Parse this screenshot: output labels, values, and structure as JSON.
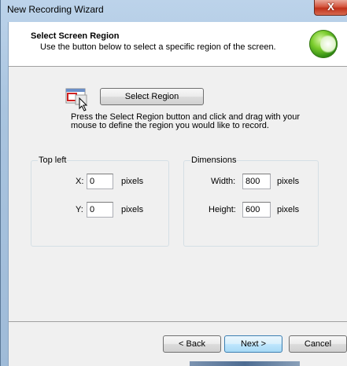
{
  "window": {
    "title": "New Recording Wizard",
    "close_glyph": "X"
  },
  "header": {
    "title": "Select Screen Region",
    "subtitle": "Use the button below to select a specific region of the screen.",
    "logo_icon": "camtasia-logo-icon"
  },
  "region": {
    "icon": "region-select-icon",
    "button_label": "Select Region",
    "instructions_line1": "Press the Select Region button and click and drag with your",
    "instructions_line2": "mouse to define the region you would like to record."
  },
  "top_left": {
    "group_label": "Top left",
    "x_label": "X:",
    "x_value": "0",
    "x_unit": "pixels",
    "y_label": "Y:",
    "y_value": "0",
    "y_unit": "pixels"
  },
  "dimensions": {
    "group_label": "Dimensions",
    "width_label": "Width:",
    "width_value": "800",
    "width_unit": "pixels",
    "height_label": "Height:",
    "height_value": "600",
    "height_unit": "pixels"
  },
  "footer": {
    "back_label": "< Back",
    "next_label": "Next >",
    "cancel_label": "Cancel"
  },
  "colors": {
    "frame": "#a9c4df",
    "close": "#c0311a",
    "dialog_bg": "#f0f0f0",
    "default_button_border": "#3c7fb1"
  }
}
